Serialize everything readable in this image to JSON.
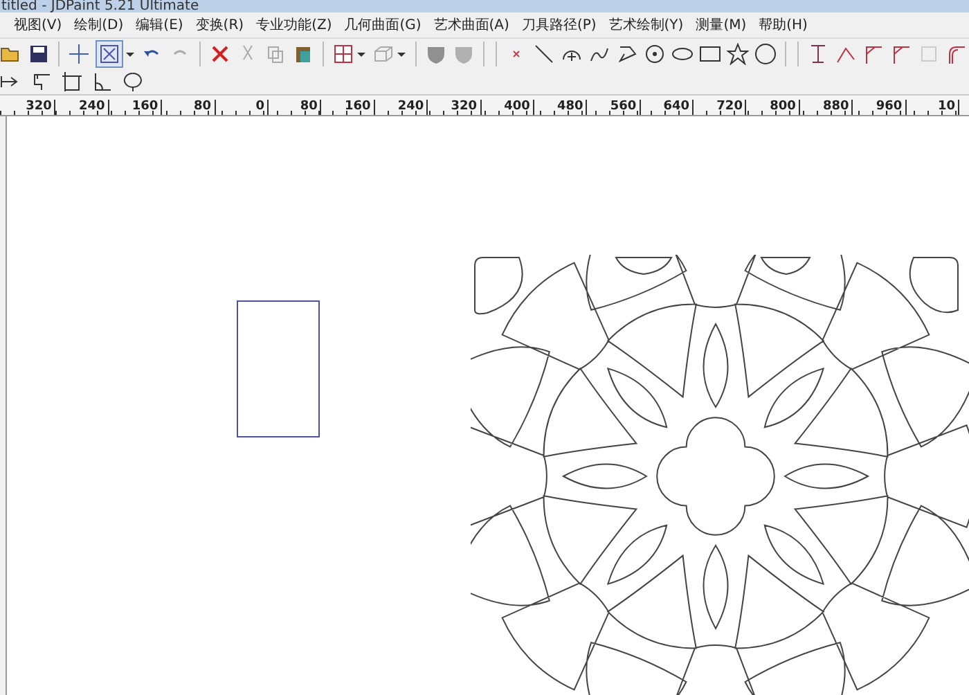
{
  "window": {
    "title": "titled - JDPaint 5.21 Ultimate"
  },
  "menu": [
    "视图(V)",
    "绘制(D)",
    "编辑(E)",
    "变换(R)",
    "专业功能(Z)",
    "几何曲面(G)",
    "艺术曲面(A)",
    "刀具路径(P)",
    "艺术绘制(Y)",
    "测量(M)",
    "帮助(H)"
  ],
  "toolbar": {
    "box_select_tool": {
      "selected": true
    }
  },
  "ruler": {
    "labels": [
      "320",
      "240",
      "160",
      "80",
      "0",
      "80",
      "160",
      "240",
      "320",
      "400",
      "480",
      "560",
      "640",
      "720",
      "800",
      "880",
      "960",
      "10"
    ]
  }
}
